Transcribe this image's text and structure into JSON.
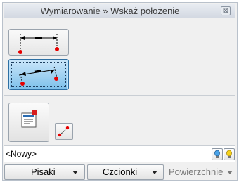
{
  "window": {
    "title": "Wymiarowanie » Wskaż położenie",
    "close_glyph": "⊠"
  },
  "tools": [
    {
      "name": "dimension-tool-horizontal",
      "icon": "horizontal-dimension-icon",
      "selected": false
    },
    {
      "name": "dimension-tool-aligned",
      "icon": "aligned-dimension-icon",
      "selected": true
    }
  ],
  "properties": {
    "big_button_icon": "dimension-style-properties-icon",
    "small_button_icon": "pick-points-icon"
  },
  "style_selector": {
    "value": "<Nowy>",
    "icon_left": "bulb-icon-blue",
    "icon_right": "bulb-icon-yellow"
  },
  "bottom_dropdowns": [
    {
      "label": "Pisaki",
      "enabled": true
    },
    {
      "label": "Czcionki",
      "enabled": true
    },
    {
      "label": "Powierzchnie",
      "enabled": false
    }
  ]
}
